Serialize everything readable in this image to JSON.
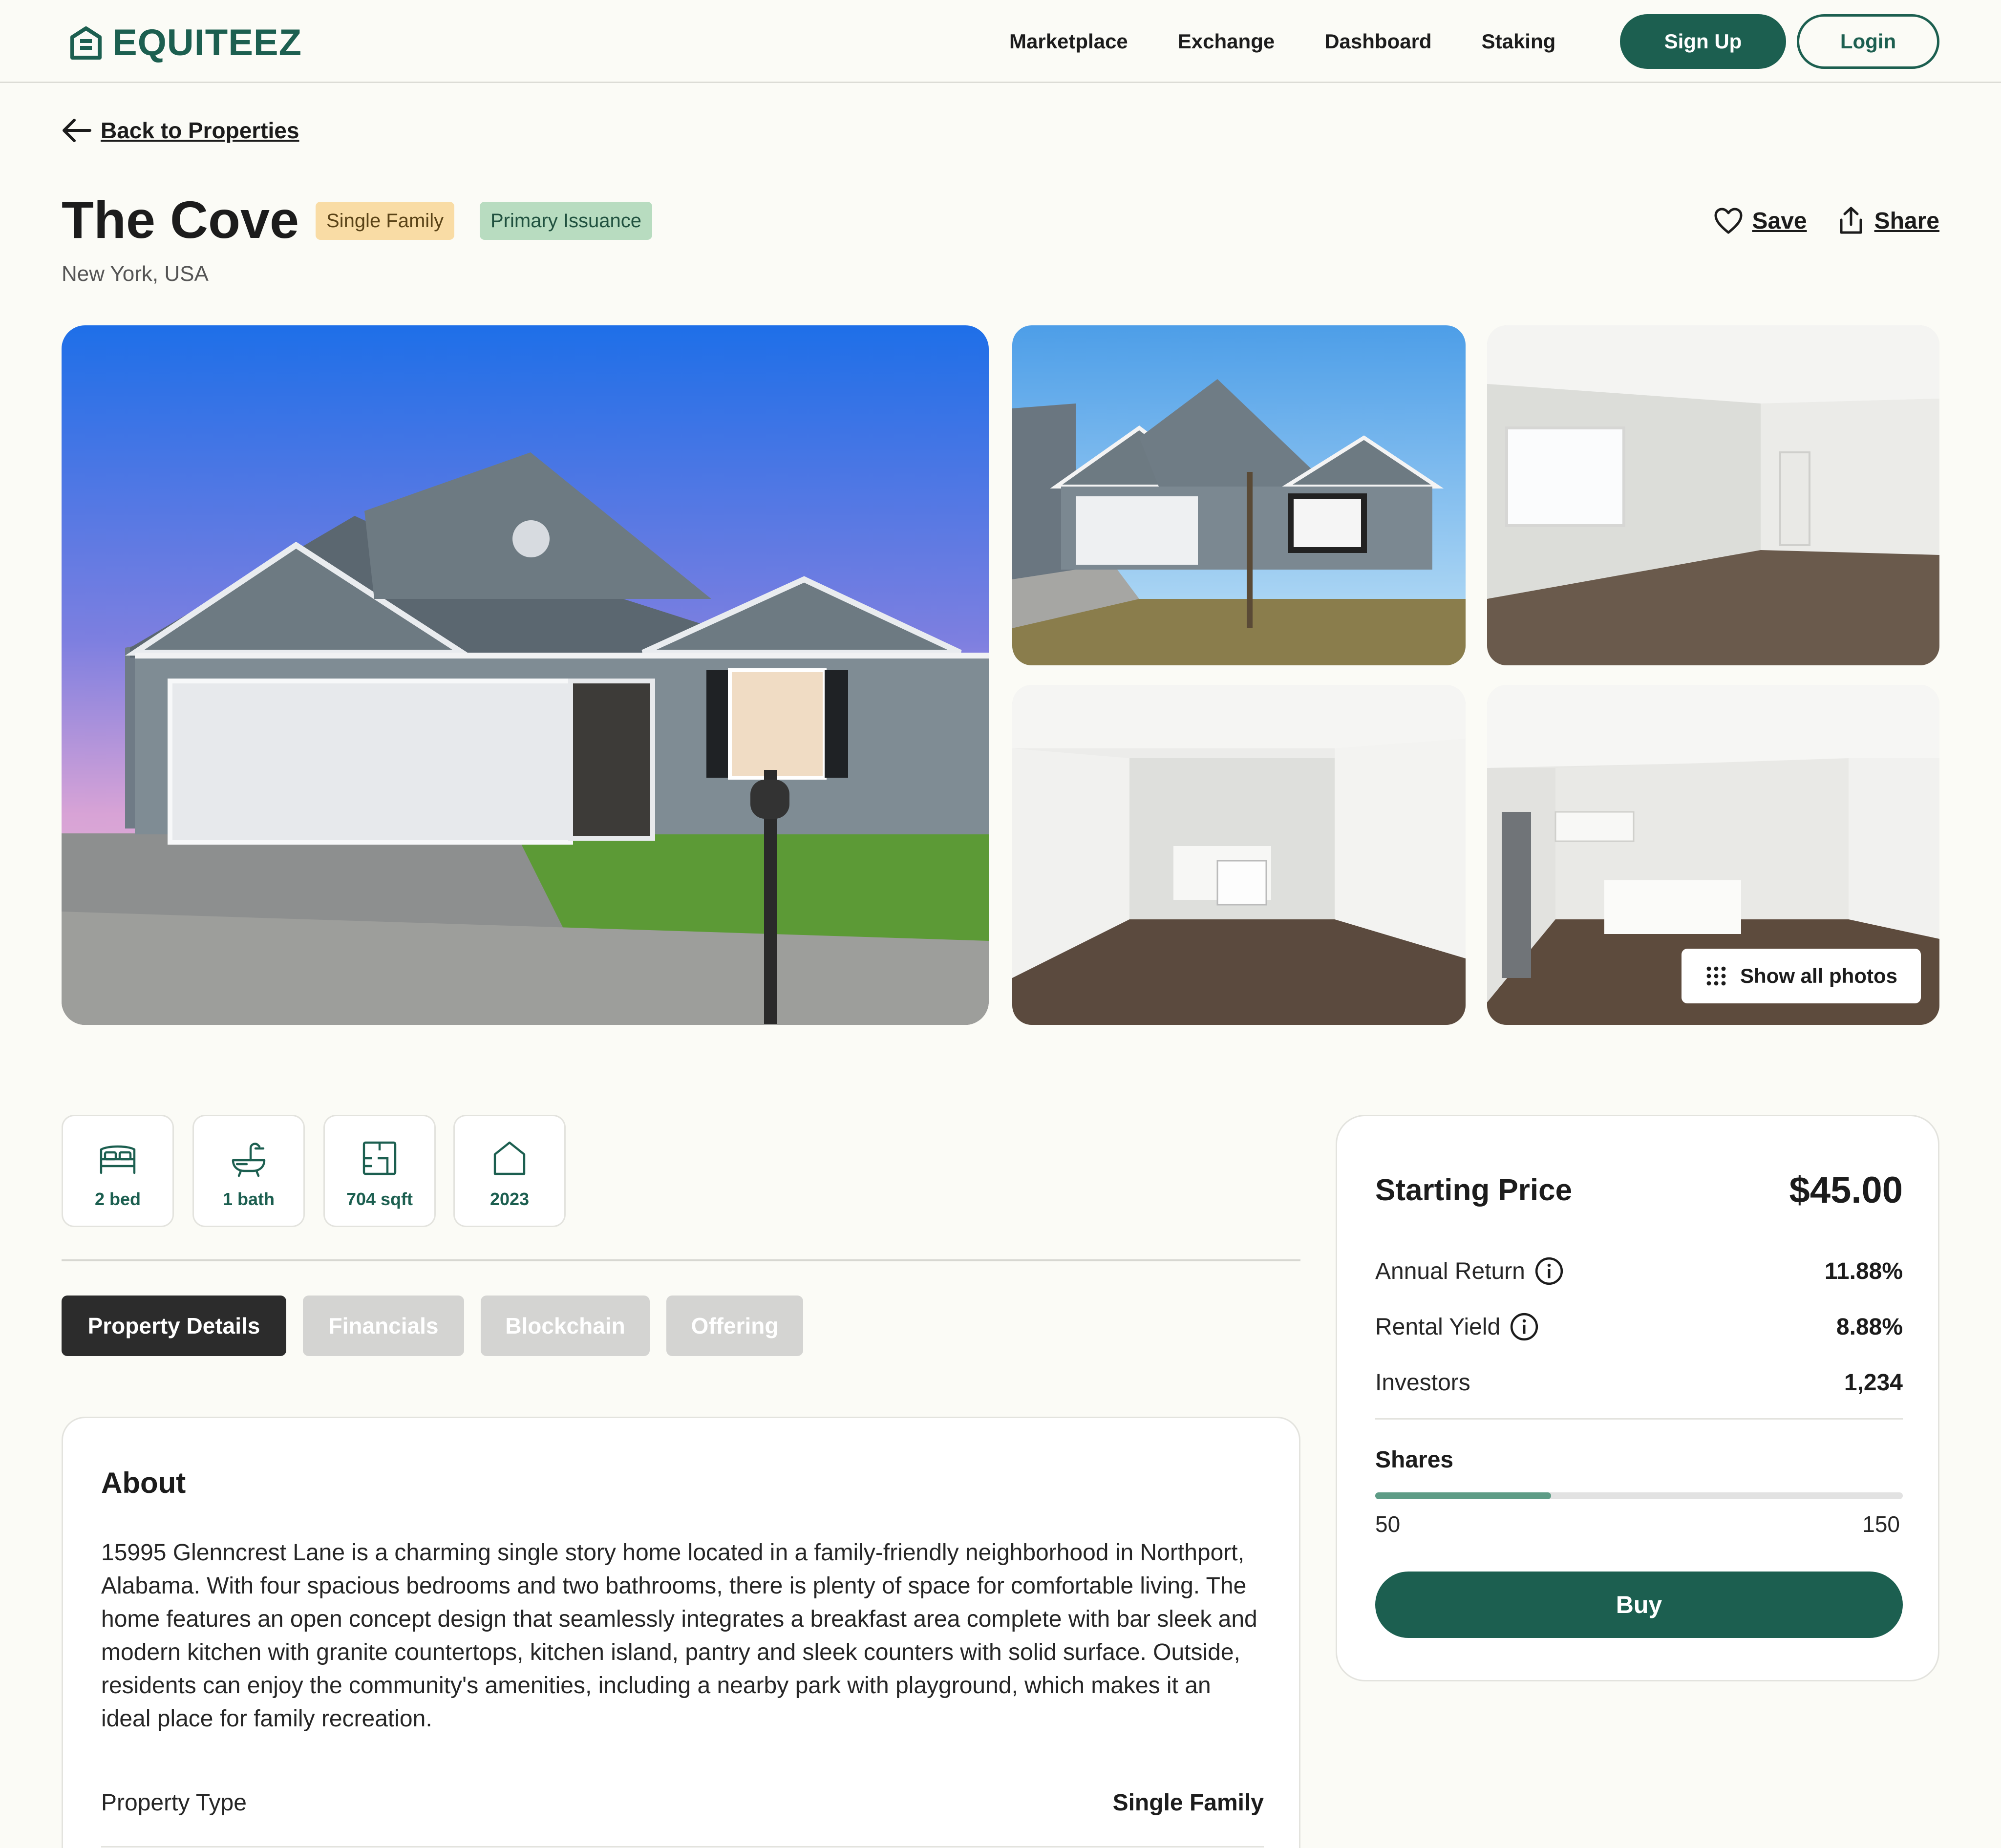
{
  "brand": {
    "name": "EQUITEEZ",
    "accent": "#1c5f50"
  },
  "nav": {
    "items": [
      "Marketplace",
      "Exchange",
      "Dashboard",
      "Staking"
    ],
    "signup_label": "Sign Up",
    "login_label": "Login"
  },
  "back_label": "Back to Properties",
  "property": {
    "title": "The Cove",
    "badges": [
      "Single Family",
      "Primary Issuance"
    ],
    "location": "New York, USA",
    "save_label": "Save",
    "share_label": "Share"
  },
  "gallery": {
    "show_all_label": "Show all photos",
    "photos": [
      "house-exterior-dusk",
      "house-exterior-day",
      "empty-living-room",
      "open-kitchen-view",
      "kitchen-island"
    ]
  },
  "features": [
    {
      "icon": "bed-icon",
      "label": "2 bed"
    },
    {
      "icon": "bath-icon",
      "label": "1 bath"
    },
    {
      "icon": "floorplan-icon",
      "label": "704 sqft"
    },
    {
      "icon": "house-icon",
      "label": "2023"
    }
  ],
  "tabs": [
    {
      "label": "Property Details",
      "active": true
    },
    {
      "label": "Financials",
      "active": false
    },
    {
      "label": "Blockchain",
      "active": false
    },
    {
      "label": "Offering",
      "active": false
    }
  ],
  "about": {
    "heading": "About",
    "text": "15995 Glenncrest Lane is a charming single story home located in a family-friendly neighborhood in Northport, Alabama. With four spacious bedrooms and two bathrooms, there is plenty of space for comfortable living. The home features an open concept design that seamlessly integrates a breakfast area complete with bar sleek and modern kitchen with granite countertops, kitchen island, pantry and sleek counters with solid surface. Outside, residents can enjoy the community's amenities, including a nearby park with playground, which makes it an ideal place for family recreation.",
    "property_type_label": "Property Type",
    "property_type_value": "Single Family"
  },
  "pricing": {
    "starting_price_label": "Starting Price",
    "starting_price_value": "$45.00",
    "annual_return_label": "Annual Return",
    "annual_return_value": "11.88%",
    "rental_yield_label": "Rental Yield",
    "rental_yield_value": "8.88%",
    "investors_label": "Investors",
    "investors_value": "1,234",
    "shares_label": "Shares",
    "shares_min": "50",
    "shares_max": "150",
    "shares_progress": 0.333,
    "buy_label": "Buy"
  }
}
